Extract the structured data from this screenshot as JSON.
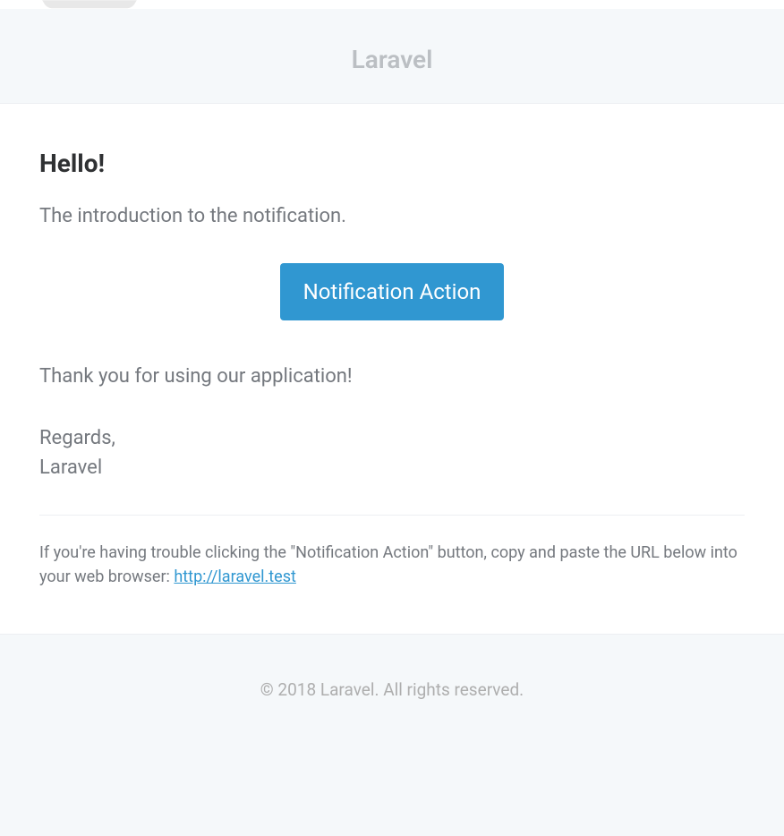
{
  "header": {
    "app_name": "Laravel"
  },
  "body": {
    "greeting": "Hello!",
    "intro_line": "The introduction to the notification.",
    "action_button_label": "Notification Action",
    "outro_line": "Thank you for using our application!",
    "salutation_regards": "Regards,",
    "salutation_name": "Laravel",
    "subcopy_prefix": "If you're having trouble clicking the \"Notification Action\" button, copy and paste the URL below into your web browser: ",
    "subcopy_url": "http://laravel.test"
  },
  "footer": {
    "copyright": "© 2018 Laravel. All rights reserved."
  },
  "colors": {
    "accent": "#3097d1",
    "background": "#f5f8fa",
    "text_muted": "#74787e",
    "heading": "#2f3133",
    "header_text": "#bbbfc3"
  }
}
